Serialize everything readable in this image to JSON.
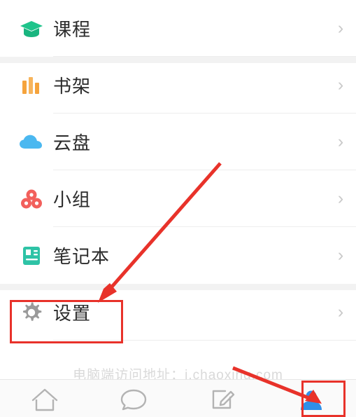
{
  "app": {
    "background_color": "#f2f2f2",
    "accent_red": "#e8322a"
  },
  "list": {
    "items": [
      {
        "label": "课程",
        "icon": "graduation-cap-icon",
        "icon_color": "#1fc48b",
        "chevron": "›"
      },
      {
        "label": "书架",
        "icon": "bookshelf-icon",
        "icon_color": "#f5a33c",
        "chevron": "›"
      },
      {
        "label": "云盘",
        "icon": "cloud-icon",
        "icon_color": "#4bb8f0",
        "chevron": "›"
      },
      {
        "label": "小组",
        "icon": "group-circles-icon",
        "icon_color": "#f2605c",
        "chevron": "›"
      },
      {
        "label": "笔记本",
        "icon": "notebook-icon",
        "icon_color": "#2ec3a6",
        "chevron": "›"
      },
      {
        "label": "设置",
        "icon": "gear-icon",
        "icon_color": "#9a9a9a",
        "chevron": "›"
      }
    ]
  },
  "watermark": {
    "text": "电脑端访问地址：i.chaoxing.com"
  },
  "tabbar": {
    "items": [
      {
        "icon": "home-icon",
        "label": ""
      },
      {
        "icon": "message-icon",
        "label": ""
      },
      {
        "icon": "compose-icon",
        "label": ""
      },
      {
        "icon": "profile-icon",
        "label": ""
      }
    ]
  },
  "annotations": {
    "settings_highlight_label": "设置",
    "profile_highlight_label": "profile-tab"
  }
}
